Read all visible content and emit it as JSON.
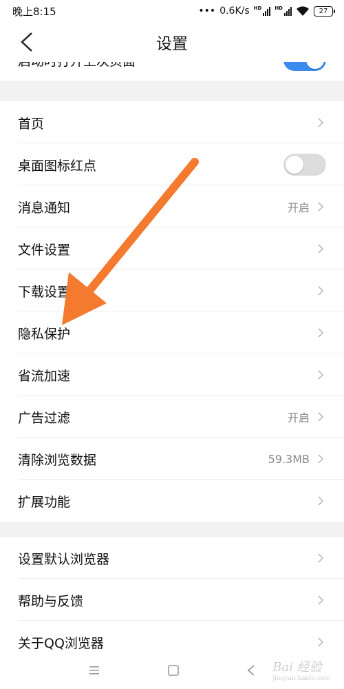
{
  "status": {
    "time": "晚上8:15",
    "speed": "0.6K/s",
    "hd": "HD",
    "battery": "27"
  },
  "header": {
    "title": "设置"
  },
  "partial_row": {
    "label": "启动时打开上次页面",
    "toggle": "on"
  },
  "group1": [
    {
      "label": "首页",
      "value": ""
    },
    {
      "label": "桌面图标红点",
      "toggle": "off"
    },
    {
      "label": "消息通知",
      "value": "开启"
    },
    {
      "label": "文件设置",
      "value": ""
    },
    {
      "label": "下载设置",
      "value": ""
    },
    {
      "label": "隐私保护",
      "value": ""
    },
    {
      "label": "省流加速",
      "value": ""
    },
    {
      "label": "广告过滤",
      "value": "开启"
    },
    {
      "label": "清除浏览数据",
      "value": "59.3MB"
    },
    {
      "label": "扩展功能",
      "value": ""
    }
  ],
  "group2": [
    {
      "label": "设置默认浏览器",
      "value": ""
    },
    {
      "label": "帮助与反馈",
      "value": ""
    },
    {
      "label": "关于QQ浏览器",
      "value": ""
    }
  ],
  "watermark": {
    "text": "Bai 经验",
    "sub": "jingyan.baidu.com"
  },
  "colors": {
    "accent": "#3b8cf0",
    "arrow": "#f47a30",
    "section_gap": "#f2f2f2"
  }
}
